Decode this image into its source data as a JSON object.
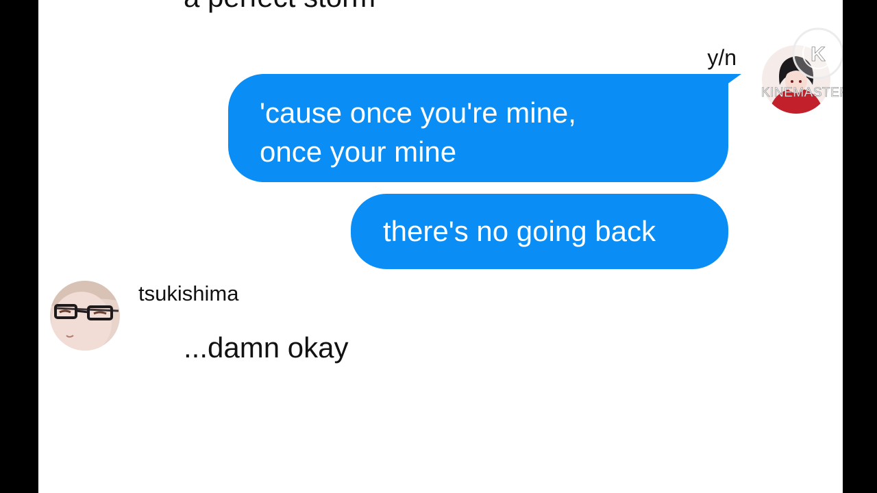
{
  "chat": {
    "previous_message": "a perfect storm",
    "outgoing": {
      "sender_name": "y/n",
      "messages": [
        {
          "line1": "'cause once you're mine,",
          "line2": "once your mine"
        },
        {
          "text": "there's no going back"
        }
      ]
    },
    "incoming": {
      "sender_name": "tsukishima",
      "message": "...damn okay"
    },
    "watermark_text": "KINEMASTER",
    "watermark_letter": "K"
  },
  "colors": {
    "bubble_blue": "#0a8ef5",
    "background": "#ffffff",
    "side_bars": "#000000"
  }
}
